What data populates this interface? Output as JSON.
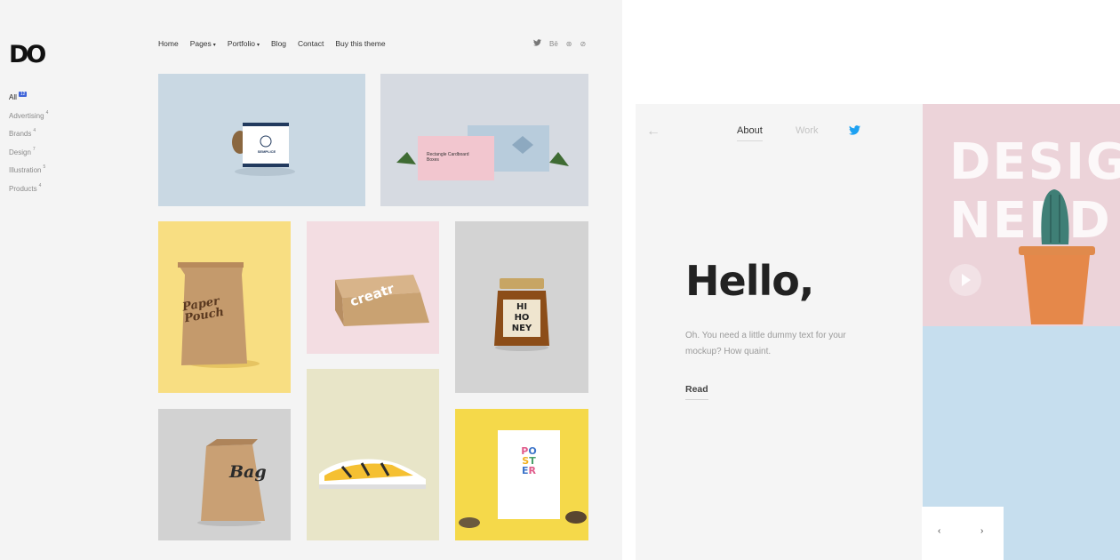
{
  "left_site": {
    "logo": "DO",
    "categories": [
      {
        "label": "All",
        "count": "12"
      },
      {
        "label": "Advertising",
        "count": "4"
      },
      {
        "label": "Brands",
        "count": "4"
      },
      {
        "label": "Design",
        "count": "7"
      },
      {
        "label": "Illustration",
        "count": "5"
      },
      {
        "label": "Products",
        "count": "4"
      }
    ],
    "nav": {
      "home": "Home",
      "pages": "Pages",
      "portfolio": "Portfolio",
      "blog": "Blog",
      "contact": "Contact",
      "buy": "Buy this theme"
    },
    "social_icons": [
      "twitter-icon",
      "behance-icon",
      "dribbble-icon",
      "pinterest-icon"
    ],
    "social_labels": [
      "🐦",
      "Bē",
      "⊛",
      "⊘"
    ],
    "tiles": {
      "mug": {
        "text": "SEMPLICE"
      },
      "boxes": {
        "text": "Rectangle Cardboard Boxes"
      },
      "pouch": {
        "text": "Paper Pouch"
      },
      "box": {
        "text": "creatr"
      },
      "jar": {
        "l1": "HI",
        "l2": "HO",
        "l3": "NEY"
      },
      "bag": {
        "text": "Bag"
      },
      "poster": {
        "letters": [
          "P",
          "O",
          "S",
          "T",
          "E",
          "R"
        ]
      }
    }
  },
  "right_site": {
    "nav": {
      "about": "About",
      "work": "Work"
    },
    "heading": "Hello,",
    "subtext": "Oh. You need a little dummy text for your mockup? How quaint.",
    "read_link": "Read",
    "hero": {
      "line1": "DESIG",
      "line2": "NERD"
    },
    "slider": {
      "prev": "‹",
      "next": "›"
    }
  },
  "colors": {
    "accent_blue": "#3d63d8",
    "twitter_blue": "#1da1f2",
    "hero_pink": "#ecd3d9",
    "hero_blue": "#c6deee",
    "tile_yellow": "#f8de82"
  }
}
